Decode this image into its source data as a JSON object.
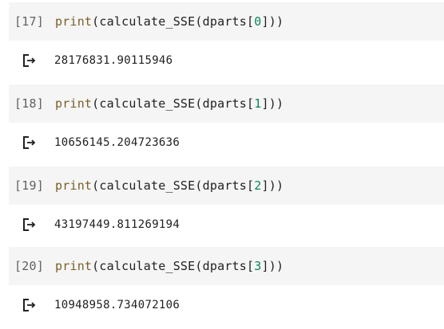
{
  "cells": [
    {
      "exec_count": "[17]",
      "code": {
        "fn": "print",
        "open": "(",
        "call": "calculate_SSE(dparts[",
        "index": "0",
        "close": "]))"
      },
      "output": "28176831.90115946",
      "output_icon": "output-arrow-icon"
    },
    {
      "exec_count": "[18]",
      "code": {
        "fn": "print",
        "open": "(",
        "call": "calculate_SSE(dparts[",
        "index": "1",
        "close": "]))"
      },
      "output": "10656145.204723636",
      "output_icon": "output-arrow-icon"
    },
    {
      "exec_count": "[19]",
      "code": {
        "fn": "print",
        "open": "(",
        "call": "calculate_SSE(dparts[",
        "index": "2",
        "close": "]))"
      },
      "output": "43197449.811269194",
      "output_icon": "output-arrow-icon"
    },
    {
      "exec_count": "[20]",
      "code": {
        "fn": "print",
        "open": "(",
        "call": "calculate_SSE(dparts[",
        "index": "3",
        "close": "]))"
      },
      "output": "10948958.734072106",
      "output_icon": "output-arrow-icon"
    }
  ],
  "colors": {
    "cell_background": "#f5f5f5",
    "function": "#795e26",
    "number": "#098658",
    "text": "#212121",
    "exec_count": "#616161"
  }
}
